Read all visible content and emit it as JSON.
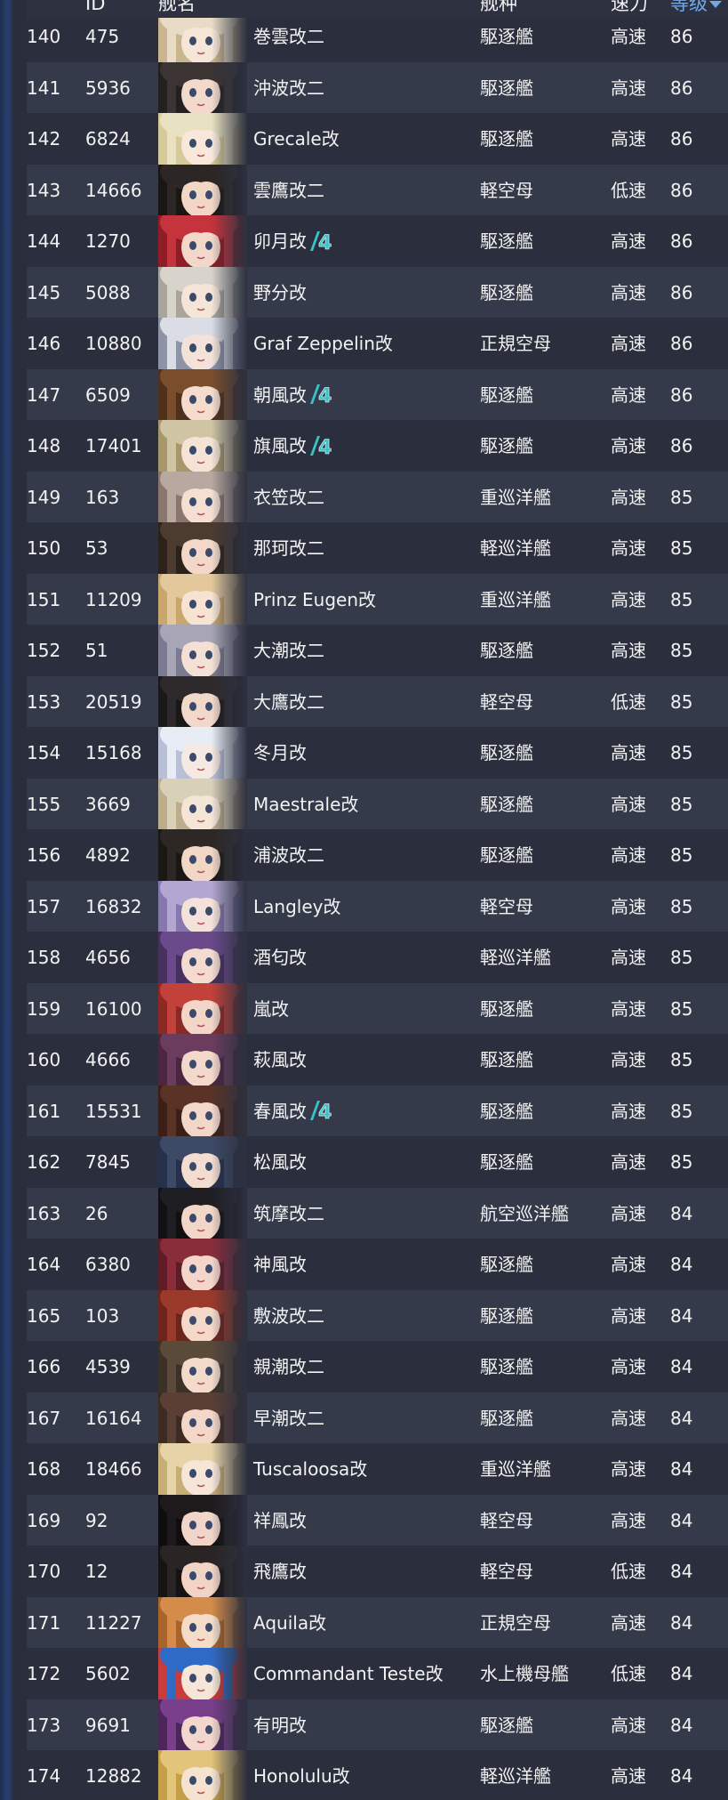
{
  "table": {
    "headers": {
      "no": "",
      "id": "ID",
      "name": "舰名",
      "type": "舰种",
      "speed": "速力",
      "level": "等级"
    },
    "sort": {
      "column": "level",
      "direction": "desc"
    },
    "rows": [
      {
        "no": "140",
        "id": "475",
        "name": "巻雲改二",
        "badge": "",
        "type": "駆逐艦",
        "speed": "高速",
        "level": "86"
      },
      {
        "no": "141",
        "id": "5936",
        "name": "沖波改二",
        "badge": "",
        "type": "駆逐艦",
        "speed": "高速",
        "level": "86"
      },
      {
        "no": "142",
        "id": "6824",
        "name": "Grecale改",
        "badge": "",
        "type": "駆逐艦",
        "speed": "高速",
        "level": "86"
      },
      {
        "no": "143",
        "id": "14666",
        "name": "雲鷹改二",
        "badge": "",
        "type": "軽空母",
        "speed": "低速",
        "level": "86"
      },
      {
        "no": "144",
        "id": "1270",
        "name": "卯月改",
        "badge": "4",
        "type": "駆逐艦",
        "speed": "高速",
        "level": "86"
      },
      {
        "no": "145",
        "id": "5088",
        "name": "野分改",
        "badge": "",
        "type": "駆逐艦",
        "speed": "高速",
        "level": "86"
      },
      {
        "no": "146",
        "id": "10880",
        "name": "Graf Zeppelin改",
        "badge": "",
        "type": "正規空母",
        "speed": "高速",
        "level": "86"
      },
      {
        "no": "147",
        "id": "6509",
        "name": "朝風改",
        "badge": "4",
        "type": "駆逐艦",
        "speed": "高速",
        "level": "86"
      },
      {
        "no": "148",
        "id": "17401",
        "name": "旗風改",
        "badge": "4",
        "type": "駆逐艦",
        "speed": "高速",
        "level": "86"
      },
      {
        "no": "149",
        "id": "163",
        "name": "衣笠改二",
        "badge": "",
        "type": "重巡洋艦",
        "speed": "高速",
        "level": "85"
      },
      {
        "no": "150",
        "id": "53",
        "name": "那珂改二",
        "badge": "",
        "type": "軽巡洋艦",
        "speed": "高速",
        "level": "85"
      },
      {
        "no": "151",
        "id": "11209",
        "name": "Prinz Eugen改",
        "badge": "",
        "type": "重巡洋艦",
        "speed": "高速",
        "level": "85"
      },
      {
        "no": "152",
        "id": "51",
        "name": "大潮改二",
        "badge": "",
        "type": "駆逐艦",
        "speed": "高速",
        "level": "85"
      },
      {
        "no": "153",
        "id": "20519",
        "name": "大鷹改二",
        "badge": "",
        "type": "軽空母",
        "speed": "低速",
        "level": "85"
      },
      {
        "no": "154",
        "id": "15168",
        "name": "冬月改",
        "badge": "",
        "type": "駆逐艦",
        "speed": "高速",
        "level": "85"
      },
      {
        "no": "155",
        "id": "3669",
        "name": "Maestrale改",
        "badge": "",
        "type": "駆逐艦",
        "speed": "高速",
        "level": "85"
      },
      {
        "no": "156",
        "id": "4892",
        "name": "浦波改二",
        "badge": "",
        "type": "駆逐艦",
        "speed": "高速",
        "level": "85"
      },
      {
        "no": "157",
        "id": "16832",
        "name": "Langley改",
        "badge": "",
        "type": "軽空母",
        "speed": "高速",
        "level": "85"
      },
      {
        "no": "158",
        "id": "4656",
        "name": "酒匂改",
        "badge": "",
        "type": "軽巡洋艦",
        "speed": "高速",
        "level": "85"
      },
      {
        "no": "159",
        "id": "16100",
        "name": "嵐改",
        "badge": "",
        "type": "駆逐艦",
        "speed": "高速",
        "level": "85"
      },
      {
        "no": "160",
        "id": "4666",
        "name": "萩風改",
        "badge": "",
        "type": "駆逐艦",
        "speed": "高速",
        "level": "85"
      },
      {
        "no": "161",
        "id": "15531",
        "name": "春風改",
        "badge": "4",
        "type": "駆逐艦",
        "speed": "高速",
        "level": "85"
      },
      {
        "no": "162",
        "id": "7845",
        "name": "松風改",
        "badge": "",
        "type": "駆逐艦",
        "speed": "高速",
        "level": "85"
      },
      {
        "no": "163",
        "id": "26",
        "name": "筑摩改二",
        "badge": "",
        "type": "航空巡洋艦",
        "speed": "高速",
        "level": "84"
      },
      {
        "no": "164",
        "id": "6380",
        "name": "神風改",
        "badge": "",
        "type": "駆逐艦",
        "speed": "高速",
        "level": "84"
      },
      {
        "no": "165",
        "id": "103",
        "name": "敷波改二",
        "badge": "",
        "type": "駆逐艦",
        "speed": "高速",
        "level": "84"
      },
      {
        "no": "166",
        "id": "4539",
        "name": "親潮改二",
        "badge": "",
        "type": "駆逐艦",
        "speed": "高速",
        "level": "84"
      },
      {
        "no": "167",
        "id": "16164",
        "name": "早潮改二",
        "badge": "",
        "type": "駆逐艦",
        "speed": "高速",
        "level": "84"
      },
      {
        "no": "168",
        "id": "18466",
        "name": "Tuscaloosa改",
        "badge": "",
        "type": "重巡洋艦",
        "speed": "高速",
        "level": "84"
      },
      {
        "no": "169",
        "id": "92",
        "name": "祥鳳改",
        "badge": "",
        "type": "軽空母",
        "speed": "高速",
        "level": "84"
      },
      {
        "no": "170",
        "id": "12",
        "name": "飛鷹改",
        "badge": "",
        "type": "軽空母",
        "speed": "低速",
        "level": "84"
      },
      {
        "no": "171",
        "id": "11227",
        "name": "Aquila改",
        "badge": "",
        "type": "正規空母",
        "speed": "高速",
        "level": "84"
      },
      {
        "no": "172",
        "id": "5602",
        "name": "Commandant Teste改",
        "badge": "",
        "type": "水上機母艦",
        "speed": "低速",
        "level": "84"
      },
      {
        "no": "173",
        "id": "9691",
        "name": "有明改",
        "badge": "",
        "type": "駆逐艦",
        "speed": "高速",
        "level": "84"
      },
      {
        "no": "174",
        "id": "12882",
        "name": "Honolulu改",
        "badge": "",
        "type": "軽巡洋艦",
        "speed": "高速",
        "level": "84"
      }
    ]
  },
  "colors": {
    "row_odd": "#2b2f3d",
    "row_even": "#353a4a",
    "sort_accent": "#6fa8e8",
    "badge_teal": "#37c3c8"
  },
  "avatar_palettes": [
    [
      "#e8dcc6",
      "#c9b68f",
      "#f6e6d8"
    ],
    [
      "#3b3433",
      "#24201f",
      "#f3d9cc"
    ],
    [
      "#e9e2c2",
      "#d6c99a",
      "#f7e8da"
    ],
    [
      "#2c2624",
      "#1a1614",
      "#f2d7c6"
    ],
    [
      "#c5333c",
      "#8e1d26",
      "#f4d7cb"
    ],
    [
      "#d8d4cc",
      "#a9a59c",
      "#f5e4d8"
    ],
    [
      "#dadce6",
      "#8e94a8",
      "#f3e2d9"
    ],
    [
      "#7a4e2c",
      "#4e301b",
      "#f5dccd"
    ],
    [
      "#cfc4a4",
      "#a8976b",
      "#f5e3d5"
    ],
    [
      "#b9a8a0",
      "#8a766d",
      "#f4dfd2"
    ],
    [
      "#4c3b2f",
      "#2c221a",
      "#f3d8c9"
    ],
    [
      "#e3c89b",
      "#c9a66c",
      "#f6e3d2"
    ],
    [
      "#a8a6b6",
      "#7c7a90",
      "#f4e0d5"
    ],
    [
      "#2e2a2c",
      "#1b1819",
      "#f2d8cb"
    ],
    [
      "#e8ecf4",
      "#b8c0d8",
      "#f6e8e2"
    ],
    [
      "#d9d0b8",
      "#bcae8c",
      "#f5e5d7"
    ],
    [
      "#2d2825",
      "#1a1715",
      "#f2d6c6"
    ],
    [
      "#b3a6d0",
      "#8678ad",
      "#f4e1d9"
    ],
    [
      "#6a4a8a",
      "#46305e",
      "#f4dbd0"
    ],
    [
      "#c2413a",
      "#8b2a24",
      "#f3d6c8"
    ],
    [
      "#6b3c5e",
      "#4a263f",
      "#f3d8cc"
    ],
    [
      "#5a3226",
      "#3b1f17",
      "#f3d7c9"
    ],
    [
      "#3d4a66",
      "#26304a",
      "#f3dcd0"
    ],
    [
      "#1f1e22",
      "#111013",
      "#f2d6c8"
    ],
    [
      "#8a2d3a",
      "#5e1c27",
      "#f3d5ca"
    ],
    [
      "#9a3a2a",
      "#6b251a",
      "#f4d8ca"
    ],
    [
      "#5a4a3a",
      "#3c3126",
      "#f3dacb"
    ],
    [
      "#5b3f35",
      "#3d2a23",
      "#f3d8ca"
    ],
    [
      "#e6d3a8",
      "#c7ad76",
      "#f6e6d8"
    ],
    [
      "#1e1a1c",
      "#0f0d0e",
      "#f2d5c9"
    ],
    [
      "#2a2424",
      "#171313",
      "#f2d4c6"
    ],
    [
      "#d58c4a",
      "#a9632b",
      "#f5dcc8"
    ],
    [
      "#2f6ac6",
      "#c93c3c",
      "#f5e6d8"
    ],
    [
      "#7a3f8a",
      "#4d2659",
      "#f3d6cd"
    ],
    [
      "#e2c47a",
      "#c49f48",
      "#f6e3cf"
    ]
  ]
}
